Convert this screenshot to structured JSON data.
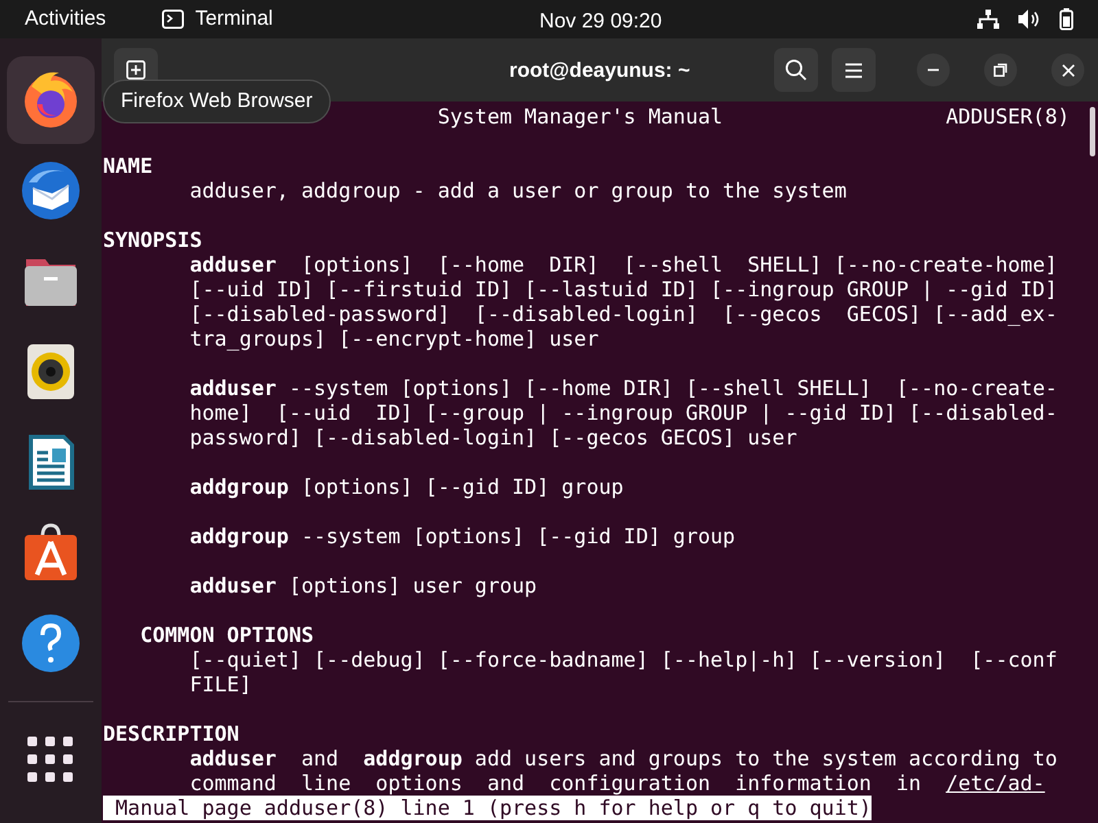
{
  "top_bar": {
    "activities": "Activities",
    "app_name": "Terminal",
    "clock": "Nov 29  09:20"
  },
  "dock": {
    "items": [
      {
        "kind": "firefox",
        "selected": true
      },
      {
        "kind": "mail",
        "selected": false
      },
      {
        "kind": "files",
        "selected": false
      },
      {
        "kind": "music",
        "selected": false
      },
      {
        "kind": "writer",
        "selected": false
      },
      {
        "kind": "store",
        "selected": false
      },
      {
        "kind": "help",
        "selected": false
      }
    ],
    "tooltip": "Firefox Web Browser"
  },
  "terminal": {
    "title": "root@deayunus: ~",
    "paragraphs": [
      {
        "lines": [
          {
            "text": "                           System Manager's Manual                  ADDUSER(8)"
          }
        ]
      },
      {
        "lines": [
          {
            "text": "**NAME**"
          },
          {
            "text": "       adduser, addgroup - add a user or group to the system"
          }
        ]
      },
      {
        "lines": [
          {
            "text": "**SYNOPSIS**"
          },
          {
            "text": "       **adduser**  [options]  [--home  DIR]  [--shell  SHELL] [--no-create-home]"
          },
          {
            "text": "       [--uid ID] [--firstuid ID] [--lastuid ID] [--ingroup GROUP | --gid ID]"
          },
          {
            "text": "       [--disabled-password]  [--disabled-login]  [--gecos  GECOS] [--add_ex-"
          },
          {
            "text": "       tra_groups] [--encrypt-home] user"
          }
        ]
      },
      {
        "lines": [
          {
            "text": "       **adduser** --system [options] [--home DIR] [--shell SHELL]  [--no-create-"
          },
          {
            "text": "       home]  [--uid  ID] [--group | --ingroup GROUP | --gid ID] [--disabled-"
          },
          {
            "text": "       password] [--disabled-login] [--gecos GECOS] user"
          }
        ]
      },
      {
        "lines": [
          {
            "text": "       **addgroup** [options] [--gid ID] group"
          }
        ]
      },
      {
        "lines": [
          {
            "text": "       **addgroup** --system [options] [--gid ID] group"
          }
        ]
      },
      {
        "lines": [
          {
            "text": "       **adduser** [options] user group"
          }
        ]
      },
      {
        "lines": [
          {
            "text": "   **COMMON OPTIONS**"
          },
          {
            "text": "       [--quiet] [--debug] [--force-badname] [--help|-h] [--version]  [--conf"
          },
          {
            "text": "       FILE]"
          }
        ]
      },
      {
        "lines": [
          {
            "text": "**DESCRIPTION**"
          },
          {
            "text": "       **adduser**  and  **addgroup** add users and groups to the system according to"
          },
          {
            "text": "       command  line  options  and  configuration  information  in  ",
            "link": "/etc/ad-"
          }
        ]
      }
    ],
    "status": " Manual page adduser(8) line 1 (press h for help or q to quit)"
  }
}
